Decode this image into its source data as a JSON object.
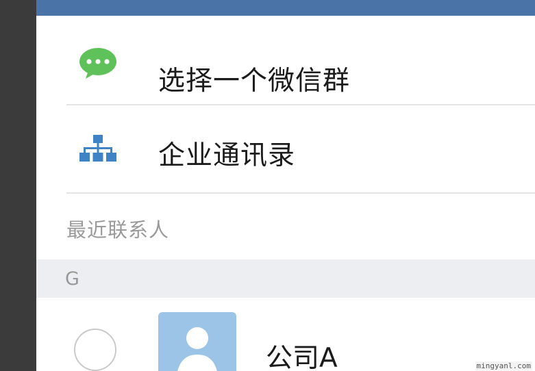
{
  "actions": {
    "select_group_label": "选择一个微信群",
    "directory_label": "企业通讯录"
  },
  "recent": {
    "title": "最近联系人",
    "groups": [
      {
        "letter": "G",
        "contacts": [
          {
            "name": "公司A",
            "selected": false
          }
        ]
      }
    ]
  },
  "watermark": "mingyanl.com",
  "icons": {
    "group": "wechat-chat-bubble-icon",
    "directory": "org-chart-icon",
    "avatar": "person-silhouette-icon"
  },
  "colors": {
    "top_bar": "#4a73a8",
    "wechat_green": "#5ec15a",
    "directory_blue": "#3f83c4",
    "avatar_bg": "#9cc4e6"
  }
}
